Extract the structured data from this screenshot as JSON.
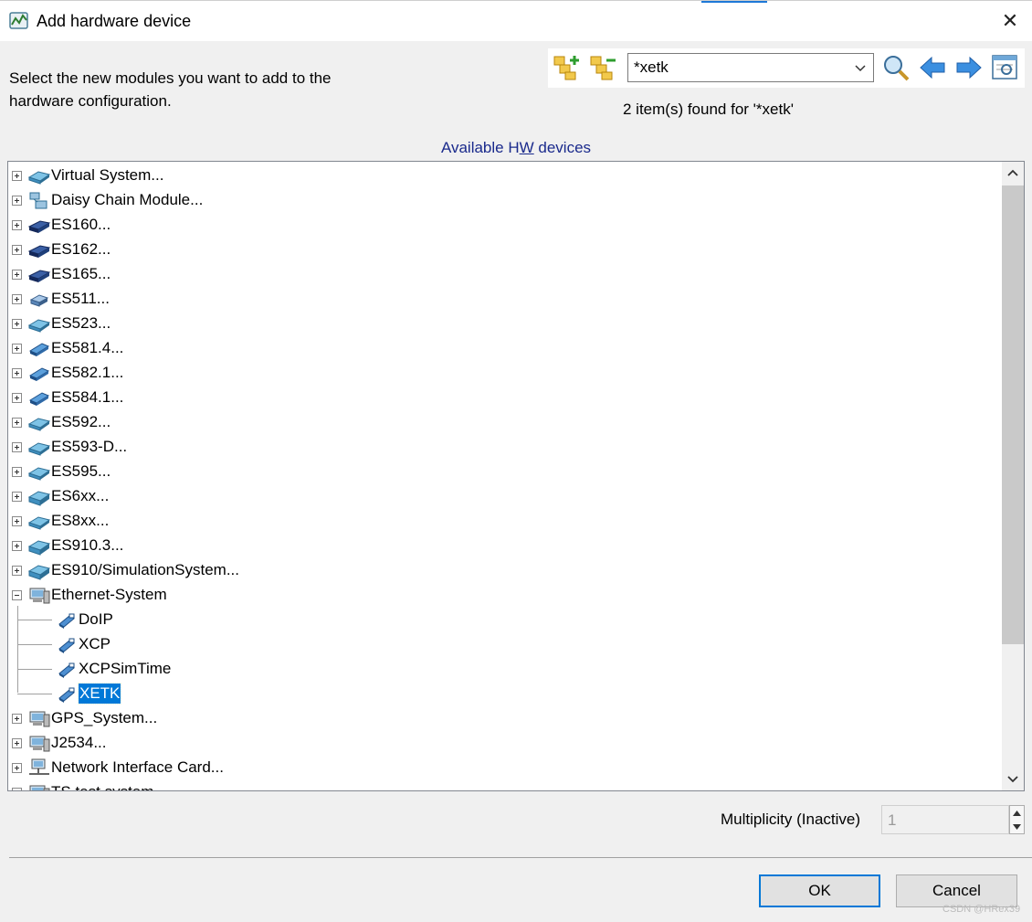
{
  "window": {
    "title": "Add hardware device",
    "close_label": "✕"
  },
  "instructions": "Select the new modules you want to add to the hardware configuration.",
  "toolbar": {
    "search_value": "*xetk",
    "icons": [
      "expand-all-icon",
      "collapse-all-icon",
      "search-icon",
      "previous-arrow-icon",
      "next-arrow-icon",
      "filter-view-icon"
    ]
  },
  "search_result": "2 item(s) found for '*xetk'",
  "tree_header": {
    "prefix": "Available H",
    "underlined": "W",
    "suffix": " devices"
  },
  "tree": {
    "items": [
      {
        "label": "Virtual System..."
      },
      {
        "label": "Daisy Chain Module..."
      },
      {
        "label": "ES160..."
      },
      {
        "label": "ES162..."
      },
      {
        "label": "ES165..."
      },
      {
        "label": "ES511..."
      },
      {
        "label": "ES523..."
      },
      {
        "label": "ES581.4..."
      },
      {
        "label": "ES582.1..."
      },
      {
        "label": "ES584.1..."
      },
      {
        "label": "ES592..."
      },
      {
        "label": "ES593-D..."
      },
      {
        "label": "ES595..."
      },
      {
        "label": "ES6xx..."
      },
      {
        "label": "ES8xx..."
      },
      {
        "label": "ES910.3..."
      },
      {
        "label": "ES910/SimulationSystem..."
      },
      {
        "label": "Ethernet-System"
      },
      {
        "label": "DoIP"
      },
      {
        "label": "XCP"
      },
      {
        "label": "XCPSimTime"
      },
      {
        "label": "XETK"
      },
      {
        "label": "GPS_System..."
      },
      {
        "label": "J2534..."
      },
      {
        "label": "Network Interface Card..."
      },
      {
        "label": "TS test system"
      }
    ]
  },
  "multiplicity": {
    "label": "Multiplicity  (Inactive)",
    "value": "1"
  },
  "buttons": {
    "ok": "OK",
    "cancel": "Cancel"
  },
  "watermark": "CSDN @HRex39",
  "colors": {
    "selection": "#0078d7",
    "header_link": "#1a2a8c"
  }
}
